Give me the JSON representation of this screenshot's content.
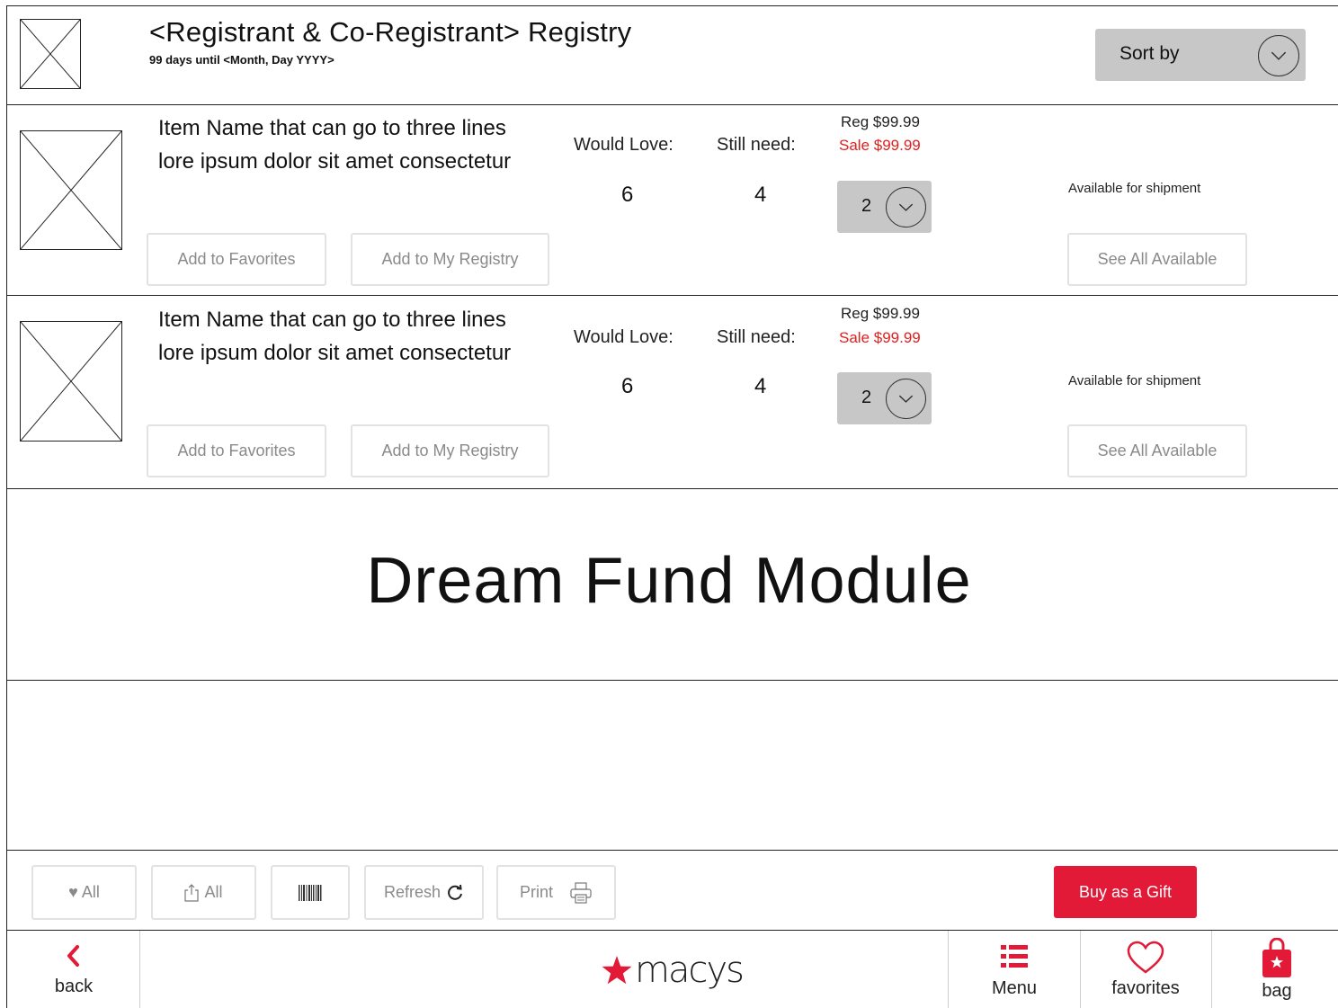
{
  "header": {
    "title": "<Registrant & Co-Registrant> Registry",
    "subtitle": "99 days until <Month, Day  YYYY>",
    "sort_label": "Sort by"
  },
  "items": [
    {
      "name": "Item Name that can go to three lines lore ipsum dolor sit amet consectetur",
      "would_love_label": "Would Love:",
      "still_need_label": "Still need:",
      "would_love": "6",
      "still_need": "4",
      "reg_price": "Reg $99.99",
      "sale_price": "Sale $99.99",
      "qty": "2",
      "availability": "Available for shipment",
      "add_favorites": "Add to Favorites",
      "add_registry": "Add to My Registry",
      "see_all": "See All Available"
    },
    {
      "name": "Item Name that can go to three lines lore ipsum dolor sit amet consectetur",
      "would_love_label": "Would Love:",
      "still_need_label": "Still need:",
      "would_love": "6",
      "still_need": "4",
      "reg_price": "Reg $99.99",
      "sale_price": "Sale $99.99",
      "qty": "2",
      "availability": "Available for shipment",
      "add_favorites": "Add to Favorites",
      "add_registry": "Add to My Registry",
      "see_all": "See All Available"
    }
  ],
  "dream_fund": "Dream Fund Module",
  "toolbar": {
    "favorite_all": "♥ All",
    "share_all": "All",
    "refresh": "Refresh",
    "print": "Print",
    "buy_gift": "Buy as a Gift"
  },
  "nav": {
    "back": "back",
    "logo_word": "macys",
    "menu": "Menu",
    "favorites": "favorites",
    "bag": "bag"
  },
  "colors": {
    "brand_red": "#e21a37",
    "sale_red": "#e0201f",
    "control_gray": "#c7c7c7"
  }
}
